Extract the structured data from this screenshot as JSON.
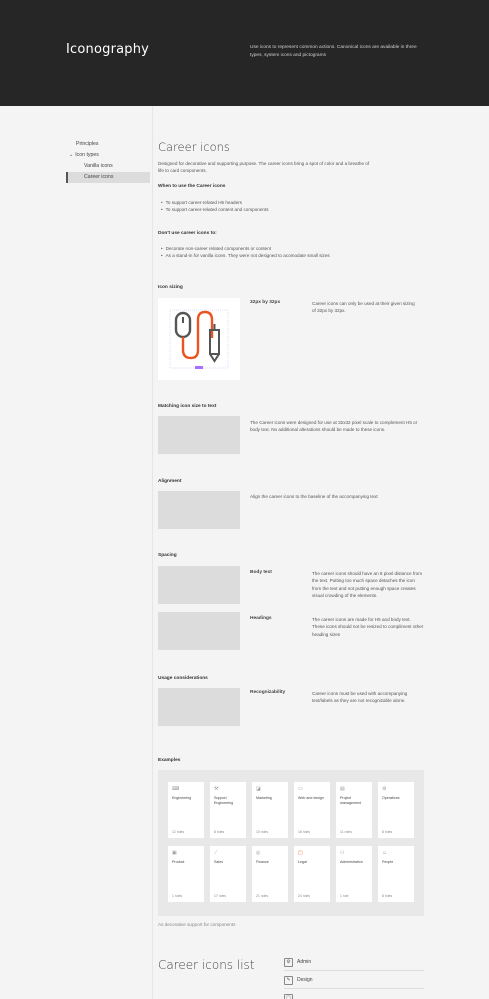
{
  "header": {
    "title": "Iconography",
    "description": "Use icons to represent common actions. Canonical icons are available in three types, system icons and pictograms"
  },
  "sidebar": {
    "items": [
      {
        "label": "Principles"
      },
      {
        "label": "Icon types",
        "icon": "chevron-down-icon"
      },
      {
        "label": "Vanilla icons"
      },
      {
        "label": "Career icons"
      }
    ]
  },
  "main": {
    "title": "Career icons",
    "intro": "Designed for decorative and supporting purpose. The career icons bring a spot of color and a breathe of life to card components.",
    "when_heading": "When to use the Career icons",
    "when_items": [
      "To support career-related H5 headers",
      "To support career-related content and components"
    ],
    "dont_heading": "Don't use career icons to:",
    "dont_items": [
      "Decorate non-career related components or content",
      "As a stand-in for vanilla icons. They were not designed to acomodate small sizes"
    ],
    "sizing": {
      "heading": "Icon sizing",
      "label": "32px by 32px",
      "text": "Career icons can only be used at their given sizing of 32px by 32px."
    },
    "matching": {
      "heading": "Matching icon size to text",
      "text": "The Career icons were designed for use at 32x32 pixel scale to complement H5 or body text. No additional alterations should be made to these icons."
    },
    "alignment": {
      "heading": "Alignment",
      "text": "Align the career icons to the baseline of the accompanying text"
    },
    "spacing": {
      "heading": "Spacing",
      "body_label": "Body text",
      "body_text": "The career icons should have an 8 pixel distance from the text. Putting too much space detaches the icon from the text and not putting enough space creates visual crowding of the elements.",
      "headings_label": "Headings",
      "headings_text": "The career icons are made for H5 and body text. These icons should not be resized to compliment other heading sizes"
    },
    "usage": {
      "heading": "Usage considerations",
      "label": "Recognizability",
      "text": "Career icons must be used with accompanying text/labels as they are not recognizable alone."
    },
    "examples": {
      "heading": "Examples",
      "cards": [
        {
          "name": "Engineering",
          "count": "12 roles",
          "icon": "keyboard-icon"
        },
        {
          "name": "Support Engineering",
          "count": "8 roles",
          "icon": "wrench-icon"
        },
        {
          "name": "Marketing",
          "count": "10 roles",
          "icon": "megaphone-icon"
        },
        {
          "name": "Web and design",
          "count": "16 roles",
          "icon": "browser-icon"
        },
        {
          "name": "Project management",
          "count": "11 roles",
          "icon": "clipboard-icon"
        },
        {
          "name": "Operations",
          "count": "8 roles",
          "icon": "gears-icon"
        },
        {
          "name": "Product",
          "count": "1 roles",
          "icon": "box-icon"
        },
        {
          "name": "Sales",
          "count": "17 roles",
          "icon": "chart-icon"
        },
        {
          "name": "Finance",
          "count": "21 roles",
          "icon": "coin-icon"
        },
        {
          "name": "Legal",
          "count": "24 roles",
          "icon": "briefcase-icon"
        },
        {
          "name": "Administration",
          "count": "1 role",
          "icon": "people-icon"
        },
        {
          "name": "People",
          "count": "8 roles",
          "icon": "person-icon"
        }
      ],
      "caption": "As decorative support for components"
    },
    "list": {
      "title": "Career icons list",
      "items": [
        {
          "label": "Admin",
          "icon": "admin-icon"
        },
        {
          "label": "Design",
          "icon": "design-icon"
        },
        {
          "label": "",
          "icon": "partial-icon"
        }
      ]
    }
  },
  "colors": {
    "header_bg": "#262626",
    "accent": "#e95420",
    "purple": "#a970ff"
  }
}
